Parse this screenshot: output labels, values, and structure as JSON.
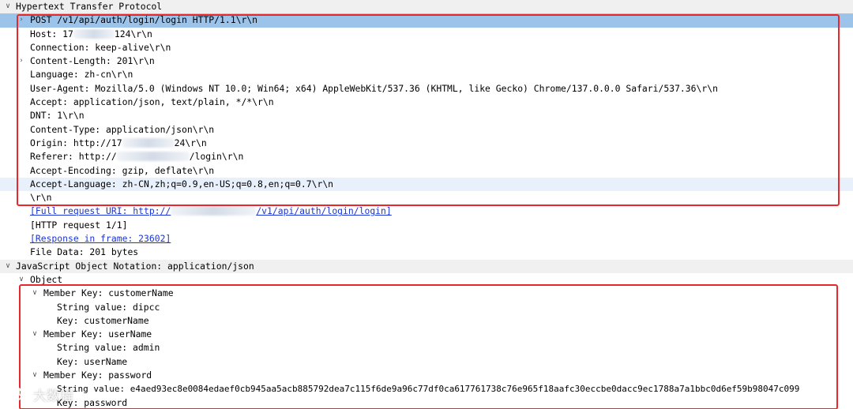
{
  "sections": {
    "http": {
      "title": "Hypertext Transfer Protocol",
      "request_line": "POST /v1/api/auth/login/login HTTP/1.1\\r\\n",
      "host": {
        "prefix": "Host: 17",
        "suffix": "124\\r\\n"
      },
      "connection": "Connection: keep-alive\\r\\n",
      "content_length": "Content-Length: 201\\r\\n",
      "language": "Language: zh-cn\\r\\n",
      "user_agent": "User-Agent: Mozilla/5.0 (Windows NT 10.0; Win64; x64) AppleWebKit/537.36 (KHTML, like Gecko) Chrome/137.0.0.0 Safari/537.36\\r\\n",
      "accept": "Accept: application/json, text/plain, */*\\r\\n",
      "dnt": "DNT: 1\\r\\n",
      "content_type": "Content-Type: application/json\\r\\n",
      "origin": {
        "prefix": "Origin: http://17",
        "suffix": "24\\r\\n"
      },
      "referer": {
        "prefix": "Referer: http://",
        "suffix": "/login\\r\\n"
      },
      "accept_encoding": "Accept-Encoding: gzip, deflate\\r\\n",
      "accept_language": "Accept-Language: zh-CN,zh;q=0.9,en-US;q=0.8,en;q=0.7\\r\\n",
      "crlf": "\\r\\n",
      "full_uri": {
        "prefix": "[Full request URI: http://",
        "suffix": "/v1/api/auth/login/login]"
      },
      "http_request": "[HTTP request 1/1]",
      "response_in_frame": "[Response in frame: 23602]",
      "file_data": "File Data: 201 bytes"
    },
    "json": {
      "title": "JavaScript Object Notation: application/json",
      "object": "Object",
      "members": [
        {
          "member": "Member Key: customerName",
          "string_value": "String value: dipcc",
          "key": "Key: customerName"
        },
        {
          "member": "Member Key: userName",
          "string_value": "String value: admin",
          "key": "Key: userName"
        },
        {
          "member": "Member Key: password",
          "string_value": "String value: e4aed93ec8e0084edaef0cb945aa5acb885792dea7c115f6de9a96c77df0ca617761738c76e965f18aafc30eccbe0dacc9ec1788a7a1bbc0d6ef59b98047c099",
          "key": "Key: password"
        }
      ]
    }
  },
  "watermark": {
    "text": "大数程"
  },
  "colors": {
    "selected_row": "#9cc3ea",
    "hover_row": "#e8f1fb",
    "section_row": "#f0f0f0",
    "link": "#1a35d6",
    "highlight_box": "#e8282b"
  }
}
